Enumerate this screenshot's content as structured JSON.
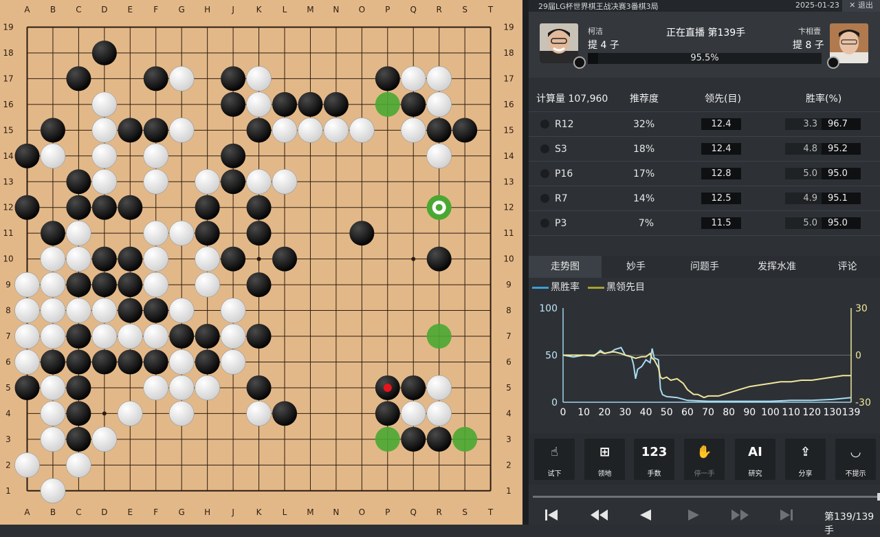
{
  "board": {
    "size": 19,
    "col_labels": [
      "A",
      "B",
      "C",
      "D",
      "E",
      "F",
      "G",
      "H",
      "J",
      "K",
      "L",
      "M",
      "N",
      "O",
      "P",
      "Q",
      "R",
      "S",
      "T"
    ],
    "row_labels": [
      "19",
      "18",
      "17",
      "16",
      "15",
      "14",
      "13",
      "12",
      "11",
      "10",
      "9",
      "8",
      "7",
      "6",
      "5",
      "4",
      "3",
      "2",
      "1"
    ],
    "star_points": [
      "D4",
      "K4",
      "Q4",
      "D10",
      "K10",
      "Q10",
      "D16",
      "K16",
      "Q16"
    ],
    "black_stones": [
      "D18",
      "C17",
      "F17",
      "J17",
      "P17",
      "J16",
      "L16",
      "M16",
      "N16",
      "Q16",
      "B15",
      "E15",
      "F15",
      "K15",
      "R15",
      "S15",
      "A14",
      "J14",
      "C13",
      "J13",
      "A12",
      "C12",
      "D12",
      "E12",
      "H12",
      "K12",
      "B11",
      "H11",
      "K11",
      "O11",
      "D10",
      "E10",
      "J10",
      "L10",
      "R10",
      "C9",
      "D9",
      "E9",
      "K9",
      "E8",
      "F8",
      "C7",
      "G7",
      "H7",
      "K7",
      "B6",
      "C6",
      "D6",
      "E6",
      "F6",
      "H6",
      "A5",
      "C5",
      "K5",
      "P5",
      "Q5",
      "C4",
      "L4",
      "P4",
      "C3",
      "Q3",
      "R3"
    ],
    "white_stones": [
      "G17",
      "K17",
      "Q17",
      "R17",
      "D16",
      "K16",
      "R16",
      "D15",
      "G15",
      "L15",
      "M15",
      "N15",
      "O15",
      "Q15",
      "B14",
      "D14",
      "F14",
      "R14",
      "D13",
      "F13",
      "H13",
      "K13",
      "L13",
      "C11",
      "F11",
      "G11",
      "B10",
      "C10",
      "F10",
      "H10",
      "A9",
      "B9",
      "F9",
      "H9",
      "A8",
      "B8",
      "C8",
      "D8",
      "G8",
      "J8",
      "A7",
      "B7",
      "D7",
      "E7",
      "F7",
      "J7",
      "A6",
      "G6",
      "J6",
      "B5",
      "F5",
      "G5",
      "H5",
      "R5",
      "B4",
      "E4",
      "G4",
      "K4",
      "Q4",
      "R4",
      "B3",
      "D3",
      "A2",
      "C2",
      "B1"
    ],
    "last_move": "P5",
    "suggest_marks": [
      "P16",
      "R7",
      "P3",
      "S3"
    ],
    "current_suggest": "R12",
    "colors": {
      "board": "#e3b888",
      "line": "#2a1c10",
      "suggest": "#49a832",
      "last_move_dot": "#e8141c"
    }
  },
  "header": {
    "title": "29届LG杯世界棋王战决赛3番棋3局",
    "date": "2025-01-23",
    "exit_label": "退出",
    "live_label": "正在直播 第139手"
  },
  "players": {
    "black": {
      "name": "柯洁",
      "captures": "提 4 子"
    },
    "white": {
      "name": "卞相壹",
      "captures": "提 8 子"
    },
    "win_rate_label": "95.5%",
    "win_rate_black": 0.045
  },
  "analysis": {
    "compute_label": "计算量 107,960",
    "col_recommend": "推荐度",
    "col_lead": "领先(目)",
    "col_winrate": "胜率(%)",
    "rows": [
      {
        "move": "R12",
        "recommend": "32%",
        "lead": "12.4",
        "wr_a": "3.3",
        "wr_b": "96.7"
      },
      {
        "move": "S3",
        "recommend": "18%",
        "lead": "12.4",
        "wr_a": "4.8",
        "wr_b": "95.2"
      },
      {
        "move": "P16",
        "recommend": "17%",
        "lead": "12.8",
        "wr_a": "5.0",
        "wr_b": "95.0"
      },
      {
        "move": "R7",
        "recommend": "14%",
        "lead": "12.5",
        "wr_a": "4.9",
        "wr_b": "95.1"
      },
      {
        "move": "P3",
        "recommend": "7%",
        "lead": "11.5",
        "wr_a": "5.0",
        "wr_b": "95.0"
      }
    ]
  },
  "tabs": [
    "走势图",
    "妙手",
    "问题手",
    "发挥水准",
    "评论"
  ],
  "legend": {
    "black_winrate": "黑胜率",
    "black_lead": "黑领先目",
    "winrate_color": "#3aa0d8",
    "lead_color": "#a8a030"
  },
  "chart_data": {
    "type": "line",
    "x_ticks": [
      0,
      10,
      20,
      30,
      40,
      50,
      60,
      70,
      80,
      90,
      100,
      110,
      120,
      130,
      139
    ],
    "y_left_ticks": [
      "100",
      "50",
      "0"
    ],
    "y_right_ticks": [
      "30",
      "0",
      "-30"
    ],
    "xlim": [
      0,
      139
    ],
    "ylim_left": [
      0,
      100
    ],
    "ylim_right": [
      -30,
      30
    ],
    "series": [
      {
        "name": "黑胜率",
        "axis": "left",
        "color": "#a8dcf0",
        "x": [
          0,
          5,
          10,
          15,
          18,
          20,
          23,
          25,
          28,
          30,
          33,
          34,
          35,
          36,
          38,
          40,
          42,
          43,
          44,
          46,
          47,
          48,
          50,
          55,
          60,
          70,
          80,
          90,
          100,
          110,
          120,
          130,
          139
        ],
        "values": [
          50,
          48,
          50,
          49,
          55,
          52,
          53,
          56,
          58,
          50,
          48,
          40,
          25,
          35,
          38,
          45,
          42,
          57,
          47,
          45,
          14,
          8,
          6,
          5,
          2,
          1,
          1,
          1,
          1,
          2,
          2,
          3,
          5
        ]
      },
      {
        "name": "黑领先目",
        "axis": "right",
        "color": "#f2e79a",
        "x": [
          0,
          5,
          10,
          15,
          18,
          20,
          23,
          25,
          28,
          30,
          33,
          35,
          38,
          40,
          42,
          43,
          44,
          46,
          47,
          48,
          50,
          52,
          55,
          58,
          60,
          63,
          65,
          68,
          70,
          75,
          80,
          85,
          90,
          95,
          100,
          105,
          110,
          115,
          120,
          125,
          130,
          135,
          139
        ],
        "values": [
          0,
          0,
          0,
          0,
          2,
          1,
          2,
          2,
          1,
          0,
          -1,
          -2,
          -1,
          -1,
          1,
          -2,
          -3,
          -8,
          -14,
          -15,
          -14,
          -16,
          -15,
          -18,
          -22,
          -25,
          -25,
          -27,
          -26,
          -26,
          -24,
          -22,
          -20,
          -19,
          -18,
          -17,
          -17,
          -16,
          -16,
          -15,
          -14,
          -13,
          -13
        ]
      }
    ]
  },
  "toolbar": [
    {
      "label": "试下",
      "icon": "touch-icon",
      "glyph": "☝",
      "enabled": true
    },
    {
      "label": "领地",
      "icon": "territory-icon",
      "glyph": "⊞",
      "enabled": true
    },
    {
      "label": "手数",
      "icon": "move-number-icon",
      "glyph": "123",
      "enabled": true
    },
    {
      "label": "停一手",
      "icon": "pass-hand-icon",
      "glyph": "✋",
      "enabled": false
    },
    {
      "label": "研究",
      "icon": "ai-icon",
      "glyph": "AI",
      "enabled": true
    },
    {
      "label": "分享",
      "icon": "share-icon",
      "glyph": "⇪",
      "enabled": true
    },
    {
      "label": "不提示",
      "icon": "hide-hint-icon",
      "glyph": "◡",
      "enabled": true
    }
  ],
  "navigation": {
    "move_counter": "第139/139手",
    "progress": 1.0
  }
}
